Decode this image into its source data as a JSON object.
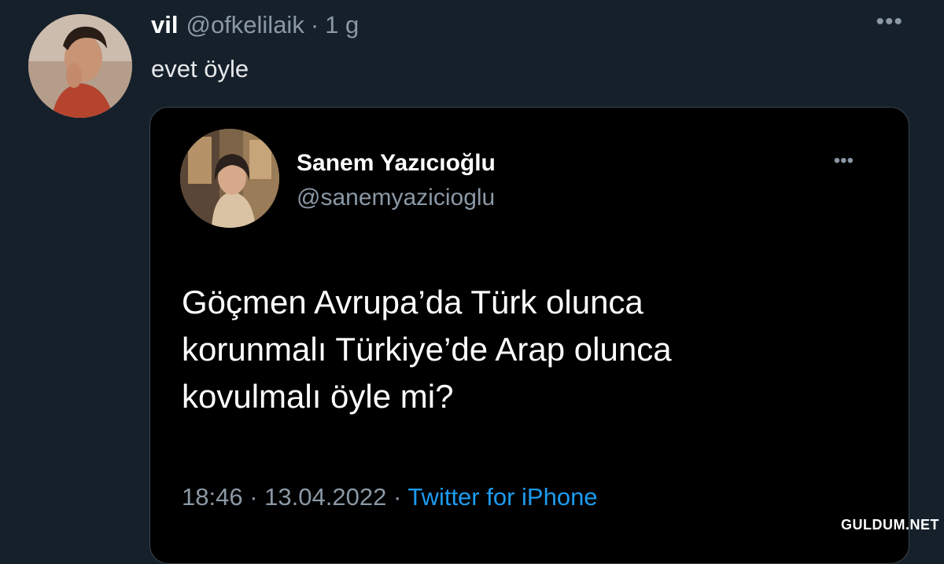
{
  "tweet": {
    "display_name": "vil",
    "handle": "@ofkelilaik",
    "separator": "·",
    "time": "1 g",
    "more_icon": "more-dots-icon",
    "text": "evet öyle"
  },
  "quote": {
    "display_name": "Sanem Yazıcıoğlu",
    "handle": "@sanemyazicioglu",
    "more_icon": "more-dots-icon",
    "body_lines": [
      "Göçmen Avrupa’da Türk olunca",
      "korunmalı Türkiye’de Arap olunca",
      "kovulmalı öyle mi?"
    ],
    "time": "18:46",
    "separator": "·",
    "date": "13.04.2022",
    "source": "Twitter for iPhone"
  },
  "watermark": "GULDUM.NET",
  "colors": {
    "background": "#15202b",
    "card_background": "#000000",
    "muted": "#8b98a5",
    "link": "#1d9bf0"
  }
}
